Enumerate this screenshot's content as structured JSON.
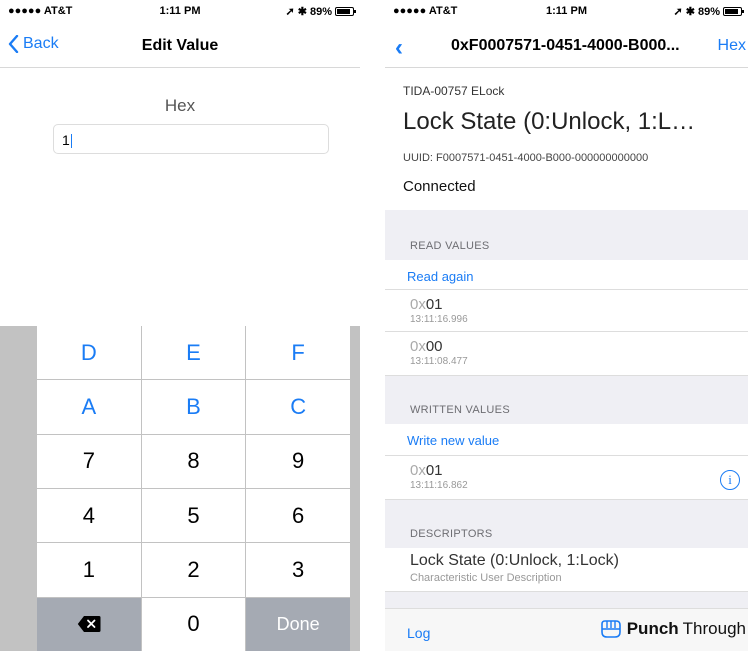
{
  "left": {
    "status": {
      "carrier": "●●●●● AT&T",
      "time": "1:11 PM",
      "battery": "89%"
    },
    "nav": {
      "back": "Back",
      "title": "Edit Value"
    },
    "field_label": "Hex",
    "input_value": "1",
    "keys": [
      "D",
      "E",
      "F",
      "A",
      "B",
      "C",
      "7",
      "8",
      "9",
      "4",
      "5",
      "6",
      "1",
      "2",
      "3",
      "",
      "0",
      "Done"
    ]
  },
  "right": {
    "status": {
      "carrier": "●●●●● AT&T",
      "time": "1:11 PM",
      "battery": "89%"
    },
    "nav": {
      "back": "‹",
      "title": "0xF0007571-0451-4000-B000...",
      "hex": "Hex"
    },
    "device": "TIDA-00757 ELock",
    "characteristic": "Lock State (0:Unlock, 1:L…",
    "uuid": "UUID: F0007571-0451-4000-B000-000000000000",
    "connection": "Connected",
    "read_header": "READ VALUES",
    "read_again": "Read again",
    "read_values": [
      {
        "prefix": "0x",
        "value": "01",
        "time": "13:11:16.996"
      },
      {
        "prefix": "0x",
        "value": "00",
        "time": "13:11:08.477"
      }
    ],
    "written_header": "WRITTEN VALUES",
    "write_new": "Write new value",
    "written_values": [
      {
        "prefix": "0x",
        "value": "01",
        "time": "13:11:16.862"
      }
    ],
    "descriptors_header": "DESCRIPTORS",
    "descriptor": {
      "title": "Lock State (0:Unlock, 1:Lock)",
      "subtitle": "Characteristic User Description"
    },
    "footer": {
      "log": "Log",
      "brand_bold": "Punch",
      "brand_light": "Through"
    }
  },
  "colors": {
    "accent": "#1a7cf5",
    "keyboard_bg": "#c2c2c2",
    "special_key": "#a5aab3",
    "section_bg": "#efeff4"
  }
}
